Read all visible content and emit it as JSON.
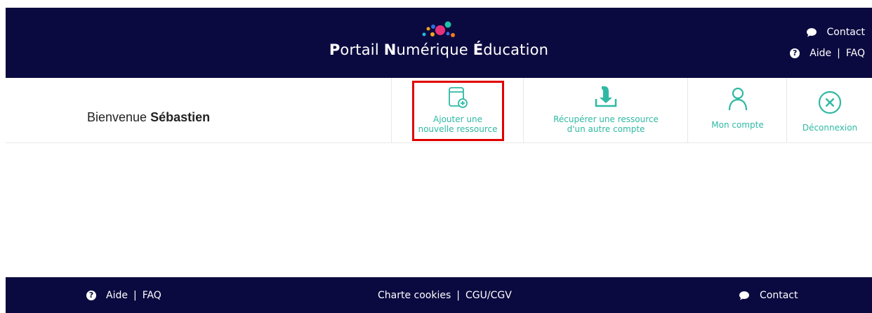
{
  "header": {
    "logo": {
      "p": "P",
      "ortail": "ortail ",
      "n": "N",
      "umerique": "umérique ",
      "e": "É",
      "ducation": "ducation"
    },
    "contact": "Contact",
    "aide": "Aide",
    "sep": "|",
    "faq": "FAQ"
  },
  "welcome": {
    "prefix": "Bienvenue ",
    "name": "Sébastien"
  },
  "nav": {
    "add_line1": "Ajouter une",
    "add_line2": "nouvelle ressource",
    "recover_line1": "Récupérer une ressource",
    "recover_line2": "d'un autre compte",
    "account": "Mon compte",
    "logout": "Déconnexion"
  },
  "footer": {
    "aide": "Aide",
    "sep": "|",
    "faq": "FAQ",
    "charte": "Charte cookies",
    "cgu": "CGU/CGV",
    "contact": "Contact"
  },
  "colors": {
    "navy": "#0b0a40",
    "teal": "#2fb9a3",
    "highlight": "#e00000"
  }
}
